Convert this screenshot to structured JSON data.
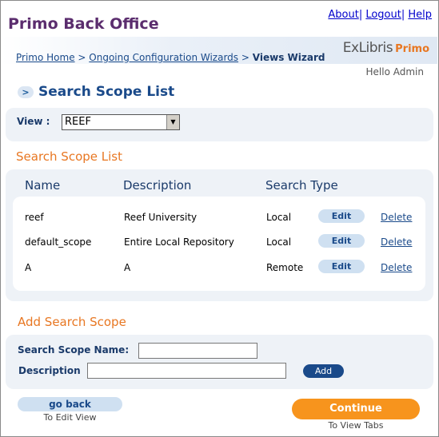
{
  "header": {
    "app_title": "Primo Back Office",
    "links": {
      "about": "About",
      "logout": "Logout",
      "help": "Help"
    },
    "logo": {
      "brand": "ExLibris",
      "product": "Primo"
    },
    "breadcrumb": {
      "home": "Primo Home",
      "wizards": "Ongoing Configuration Wizards",
      "current": "Views Wizard"
    },
    "greeting": "Hello Admin"
  },
  "page": {
    "title_icon": "chevron-right-icon",
    "title": "Search Scope List"
  },
  "view_selector": {
    "label": "View :",
    "selected": "REEF"
  },
  "scope_list": {
    "heading": "Search Scope List",
    "columns": {
      "name": "Name",
      "description": "Description",
      "search_type": "Search Type"
    },
    "rows": [
      {
        "name": "reef",
        "description": "Reef University",
        "search_type": "Local",
        "edit": "Edit",
        "delete": "Delete"
      },
      {
        "name": "default_scope",
        "description": "Entire Local Repository",
        "search_type": "Local",
        "edit": "Edit",
        "delete": "Delete"
      },
      {
        "name": "A",
        "description": "A",
        "search_type": "Remote",
        "edit": "Edit",
        "delete": "Delete"
      }
    ]
  },
  "add_scope": {
    "heading": "Add Search Scope",
    "name_label": "Search Scope Name:",
    "name_value": "",
    "description_label": "Description",
    "description_value": "",
    "add_button": "Add"
  },
  "navigation": {
    "back_button": "go back",
    "back_caption": "To Edit View",
    "continue_button": "Continue",
    "continue_caption": "To View Tabs"
  },
  "colors": {
    "title_purple": "#5b2d6e",
    "accent_orange": "#e87722",
    "continue_orange": "#f7941d",
    "navy": "#1a4a8a",
    "panel_bg": "#eef2f7"
  }
}
